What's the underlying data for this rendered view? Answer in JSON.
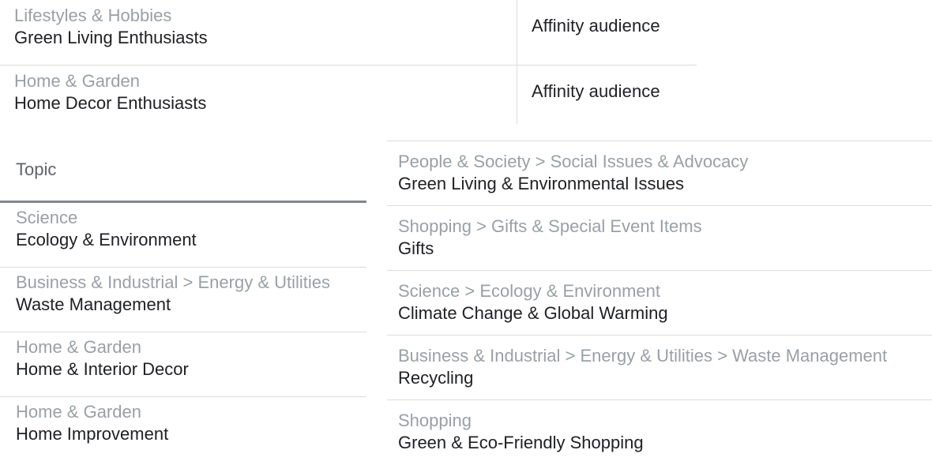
{
  "audiences": [
    {
      "category": "Lifestyles & Hobbies",
      "name": "Green Living Enthusiasts",
      "type": "Affinity audience"
    },
    {
      "category": "Home & Garden",
      "name": "Home Decor Enthusiasts",
      "type": "Affinity audience"
    }
  ],
  "topic_panel": {
    "header": "Topic",
    "items": [
      {
        "category": "Science",
        "name": "Ecology & Environment"
      },
      {
        "category": "Business & Industrial > Energy & Utilities",
        "name": "Waste Management"
      },
      {
        "category": "Home & Garden",
        "name": "Home & Interior Decor"
      },
      {
        "category": "Home & Garden",
        "name": "Home Improvement"
      }
    ]
  },
  "related_topics": [
    {
      "category": "People & Society > Social Issues & Advocacy",
      "name": "Green Living & Environmental Issues"
    },
    {
      "category": "Shopping > Gifts & Special Event Items",
      "name": "Gifts"
    },
    {
      "category": "Science > Ecology & Environment",
      "name": "Climate Change & Global Warming"
    },
    {
      "category": "Business & Industrial > Energy & Utilities > Waste Management",
      "name": "Recycling"
    },
    {
      "category": "Shopping",
      "name": "Green & Eco-Friendly Shopping"
    }
  ]
}
